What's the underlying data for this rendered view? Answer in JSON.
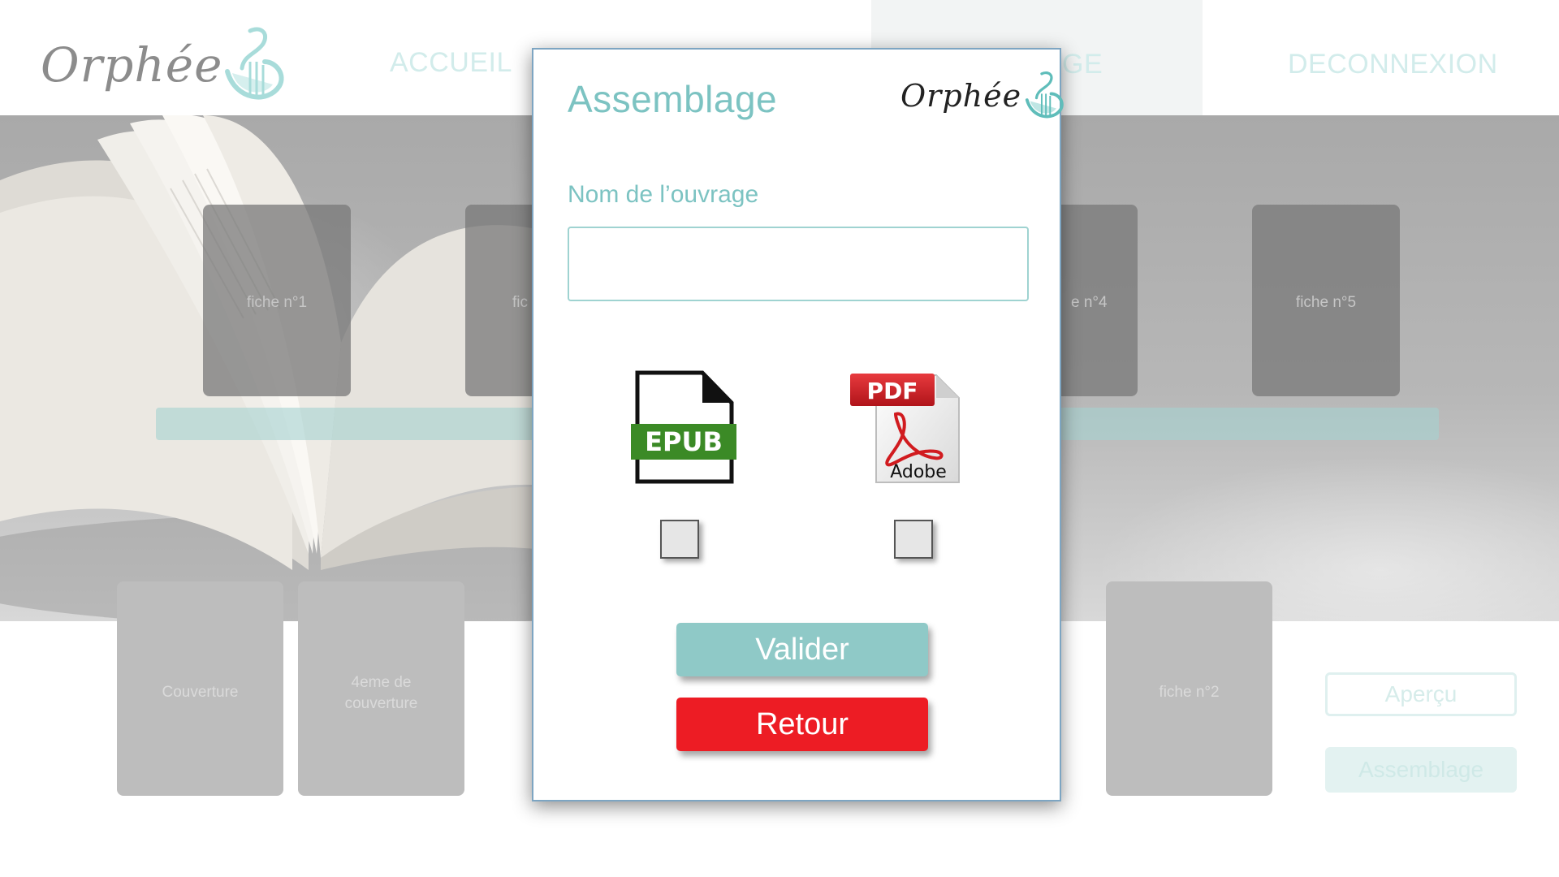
{
  "background": {
    "logo": {
      "text": "Orphée"
    },
    "nav": {
      "home": "ACCUEIL",
      "active_partial": "GE",
      "logout": "DECONNEXION"
    },
    "fiches": [
      {
        "label": "fiche n°1"
      },
      {
        "label": "fic"
      },
      {
        "label": "e n°4"
      },
      {
        "label": "fiche n°5"
      }
    ],
    "bottom_cards": [
      {
        "label": "Couverture"
      },
      {
        "label": "4eme de couverture"
      },
      {
        "label": "fiche n°2"
      }
    ],
    "buttons": {
      "apercu": "Aperçu",
      "assemblage": "Assemblage"
    }
  },
  "modal": {
    "title": "Assemblage",
    "logo": {
      "text": "Orphée"
    },
    "field_label": "Nom de l’ouvrage",
    "field_value": "",
    "formats": {
      "epub": {
        "icon_text": "EPUB",
        "checked": false
      },
      "pdf": {
        "icon_text": "PDF",
        "icon_subtext": "Adobe",
        "checked": false
      }
    },
    "buttons": {
      "valider": "Valider",
      "retour": "Retour"
    }
  },
  "colors": {
    "accent_teal": "#7cc3c2",
    "button_teal": "#8fc9c7",
    "button_red": "#ed1c24",
    "epub_green": "#3b8a26",
    "pdf_red": "#d11b1f"
  },
  "icons": {
    "logo": "lyre-icon",
    "epub": "epub-file-icon",
    "pdf": "pdf-file-icon"
  }
}
